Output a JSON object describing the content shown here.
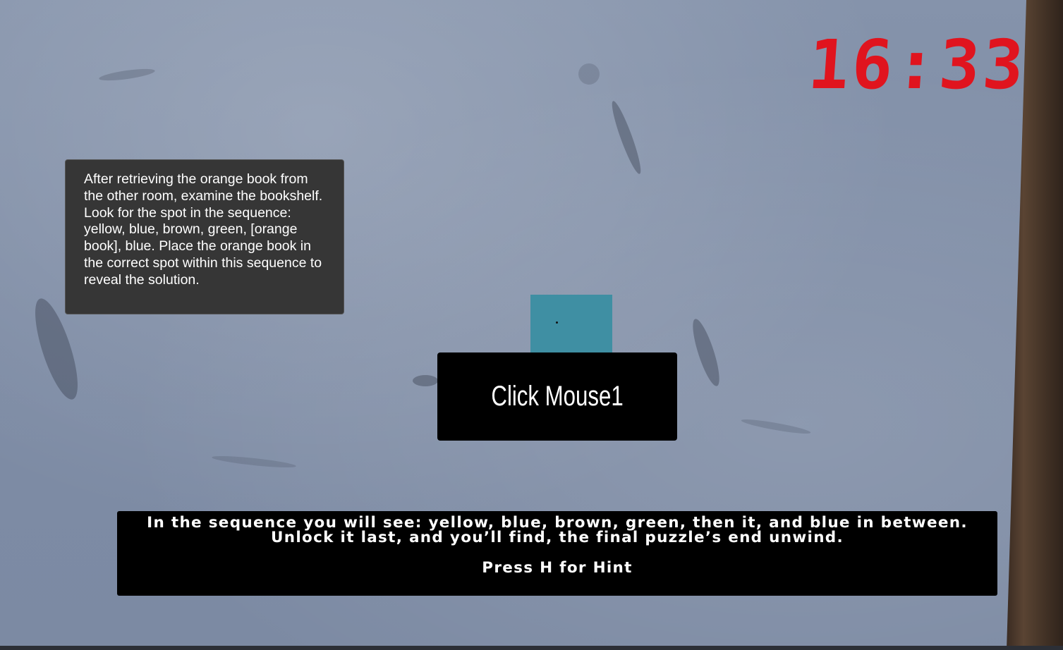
{
  "hud": {
    "timer": "16:33"
  },
  "hint_panel": {
    "text": "After retrieving the orange book from the other room, examine the bookshelf. Look for the spot in the sequence: yellow, blue, brown, green, [orange book], blue. Place the orange book in the correct spot within this sequence to reveal the solution."
  },
  "prompt": {
    "label": "Click Mouse1"
  },
  "riddle": {
    "text": "In the sequence you will see: yellow, blue, brown, green, then it, and blue in between. Unlock it last, and you’ll find, the final puzzle’s end unwind.",
    "hint_instruction": "Press H for Hint"
  },
  "colors": {
    "timer": "#e0141e",
    "teal_object": "#3f8fa3",
    "panel_bg": "#363636",
    "overlay_bg": "#000000"
  }
}
